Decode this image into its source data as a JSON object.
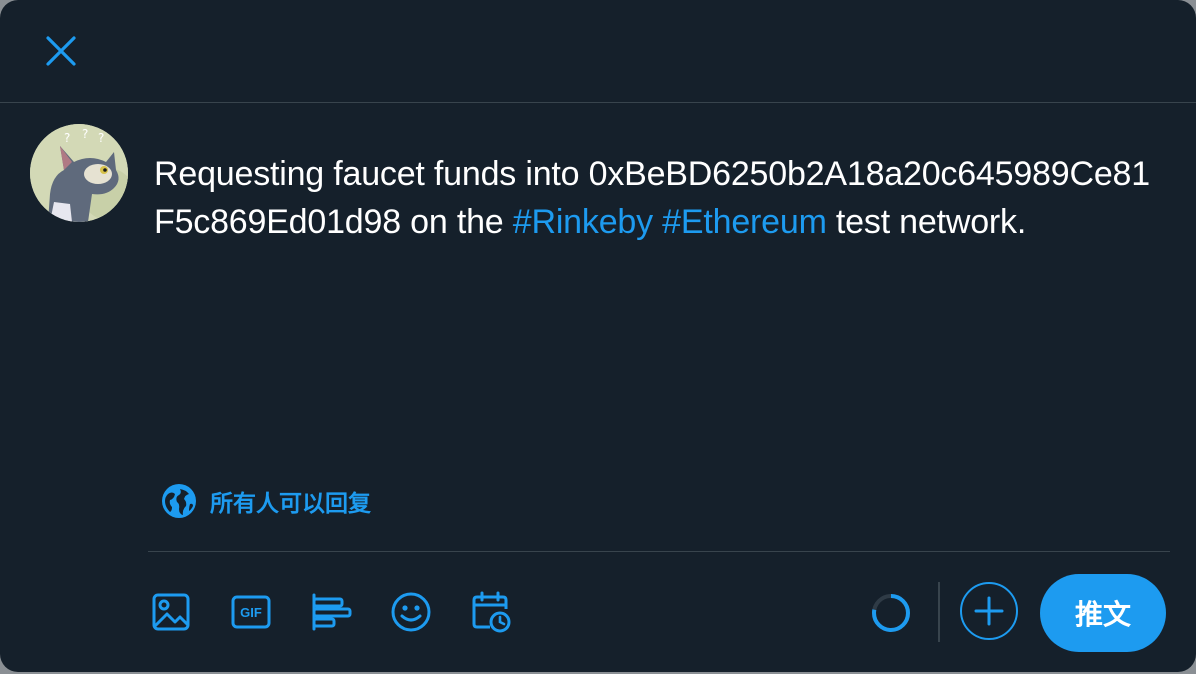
{
  "compose": {
    "text_before": "Requesting faucet funds into 0xBeBD6250b2A18a20c645989Ce81F5c869Ed01d98 on the ",
    "hashtag_1": "#Rinkeby",
    "space": " ",
    "hashtag_2": "#Ethereum",
    "text_after": " test network."
  },
  "reply_setting": {
    "label": "所有人可以回复",
    "icon": "globe-icon"
  },
  "toolbar": {
    "tools": [
      "image-icon",
      "gif-icon",
      "poll-icon",
      "emoji-icon",
      "schedule-icon"
    ],
    "gif_label": "GIF",
    "tweet_label": "推文",
    "char_progress": 0.78
  },
  "colors": {
    "accent": "#1d9bf0",
    "background": "#15202b",
    "border": "#38444d",
    "text": "#ffffff"
  }
}
